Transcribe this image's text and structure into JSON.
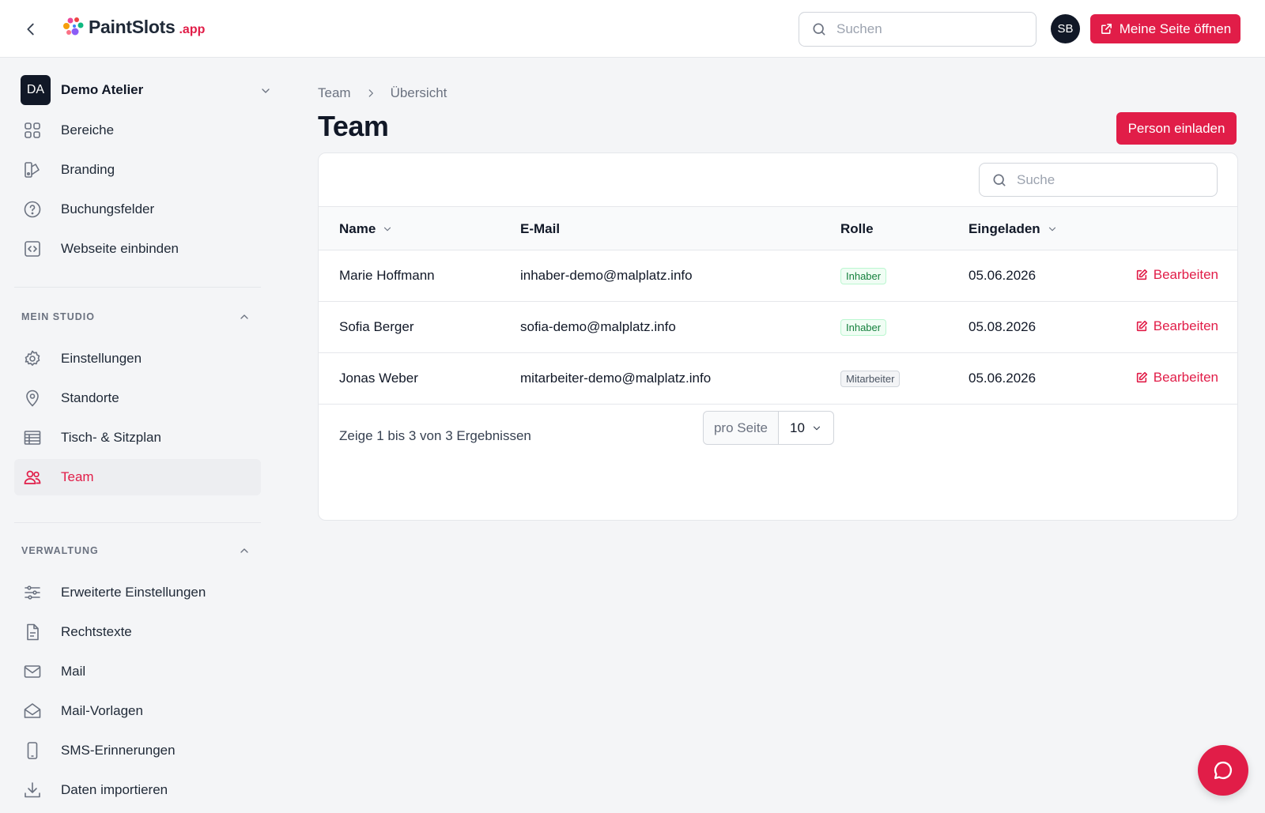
{
  "topbar": {
    "logo_main": "PaintSlots",
    "logo_tld": ".app",
    "search_placeholder": "Suchen",
    "avatar_initials": "SB",
    "open_site_label": "Meine Seite öffnen"
  },
  "sidebar": {
    "studio": {
      "initials": "DA",
      "name": "Demo Atelier"
    },
    "top_items": [
      {
        "label": "Bereiche",
        "icon": "grid-icon"
      },
      {
        "label": "Branding",
        "icon": "palette-icon"
      },
      {
        "label": "Buchungsfelder",
        "icon": "help-circle-icon"
      },
      {
        "label": "Webseite einbinden",
        "icon": "code-icon"
      }
    ],
    "section_studio": {
      "title": "MEIN STUDIO",
      "items": [
        {
          "label": "Einstellungen",
          "icon": "gear-icon"
        },
        {
          "label": "Standorte",
          "icon": "map-pin-icon"
        },
        {
          "label": "Tisch- & Sitzplan",
          "icon": "table-icon"
        },
        {
          "label": "Team",
          "icon": "users-icon",
          "active": true
        }
      ]
    },
    "section_admin": {
      "title": "VERWALTUNG",
      "items": [
        {
          "label": "Erweiterte Einstellungen",
          "icon": "sliders-icon"
        },
        {
          "label": "Rechtstexte",
          "icon": "document-icon"
        },
        {
          "label": "Mail",
          "icon": "mail-icon"
        },
        {
          "label": "Mail-Vorlagen",
          "icon": "mail-open-icon"
        },
        {
          "label": "SMS-Erinnerungen",
          "icon": "phone-icon"
        },
        {
          "label": "Daten importieren",
          "icon": "download-icon"
        }
      ]
    }
  },
  "main": {
    "breadcrumb": [
      "Team",
      "Übersicht"
    ],
    "title": "Team",
    "invite_label": "Person einladen",
    "table_search_placeholder": "Suche",
    "columns": {
      "name": "Name",
      "email": "E-Mail",
      "role": "Rolle",
      "invited": "Eingeladen"
    },
    "rows": [
      {
        "name": "Marie Hoffmann",
        "email": "inhaber-demo@malplatz.info",
        "role": "Inhaber",
        "role_type": "owner",
        "invited": "05.06.2026",
        "action": "Bearbeiten"
      },
      {
        "name": "Sofia Berger",
        "email": "sofia-demo@malplatz.info",
        "role": "Inhaber",
        "role_type": "owner",
        "invited": "05.08.2026",
        "action": "Bearbeiten"
      },
      {
        "name": "Jonas Weber",
        "email": "mitarbeiter-demo@malplatz.info",
        "role": "Mitarbeiter",
        "role_type": "staff",
        "invited": "05.06.2026",
        "action": "Bearbeiten"
      }
    ],
    "results_text": "Zeige 1 bis 3 von 3 Ergebnissen",
    "per_page_label": "pro Seite",
    "per_page_value": "10"
  },
  "colors": {
    "accent": "#e11d48",
    "dark": "#111827",
    "owner_badge": "#15803d"
  }
}
